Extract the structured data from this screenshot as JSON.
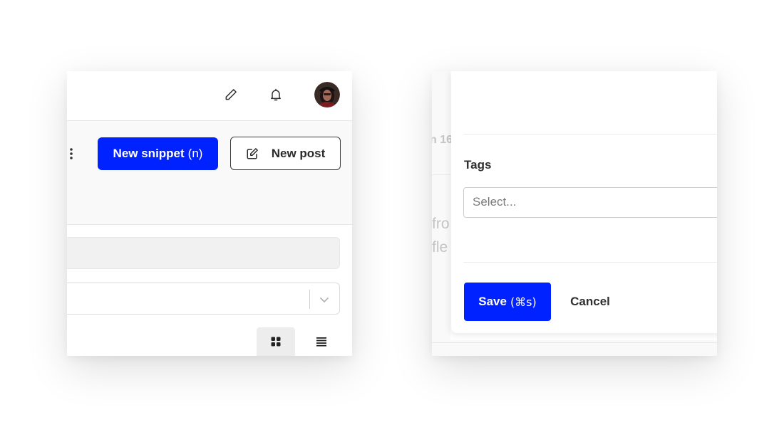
{
  "toolbar": {
    "edit_icon": "pencil-icon",
    "notifications_icon": "bell-icon",
    "avatar_alt": "user avatar"
  },
  "actions": {
    "new_snippet_label": "New snippet",
    "new_snippet_shortcut": "(n)",
    "new_post_label": "New post",
    "more_icon": "vertical-dots-icon"
  },
  "filters": {
    "search_value": "",
    "select_value": ""
  },
  "view_toggle": {
    "grid_icon": "grid-icon",
    "list_icon": "list-icon",
    "active": "grid"
  },
  "background": {
    "date_fragment": "n 16",
    "line1_fragment": "fro",
    "line2_fragment": "fle"
  },
  "modal": {
    "tags_label": "Tags",
    "tags_placeholder": "Select...",
    "save_label": "Save",
    "save_shortcut": "(⌘s)",
    "cancel_label": "Cancel"
  },
  "colors": {
    "primary": "#0022ff",
    "text": "#2f2f2f",
    "muted_text": "#c4c4c4"
  }
}
